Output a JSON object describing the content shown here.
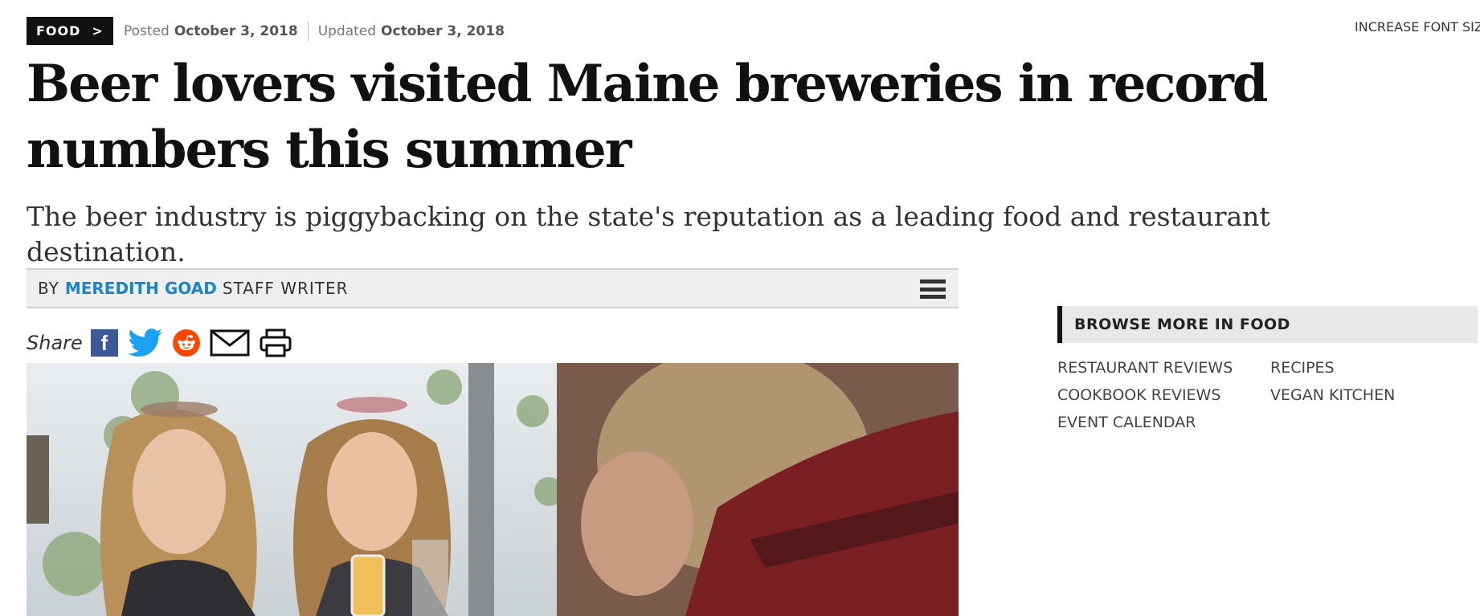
{
  "section": {
    "label": "FOOD",
    "chevron": ">"
  },
  "dates": {
    "posted_label": "Posted",
    "posted_date": "October 3, 2018",
    "updated_label": "Updated",
    "updated_date": "October 3, 2018"
  },
  "font_size_link": "INCREASE FONT SIZE",
  "headline": "Beer lovers visited Maine breweries in record numbers this summer",
  "dek": "The beer industry is piggybacking on the state's reputation as a leading food and restaurant destination.",
  "byline": {
    "by": "BY",
    "author": "MEREDITH GOAD",
    "role": "STAFF WRITER"
  },
  "share": {
    "label": "Share",
    "facebook_glyph": "f",
    "icons": [
      "facebook-icon",
      "twitter-icon",
      "reddit-icon",
      "email-icon",
      "print-icon"
    ]
  },
  "sidebar": {
    "heading": "BROWSE MORE IN FOOD",
    "links": [
      "RESTAURANT REVIEWS",
      "RECIPES",
      "COOKBOOK REVIEWS",
      "VEGAN KITCHEN",
      "EVENT CALENDAR"
    ]
  },
  "colors": {
    "author_link": "#1a86c9",
    "facebook": "#3b5998",
    "twitter": "#1da1f2",
    "reddit": "#ff4500",
    "section_tag_bg": "#111111"
  }
}
